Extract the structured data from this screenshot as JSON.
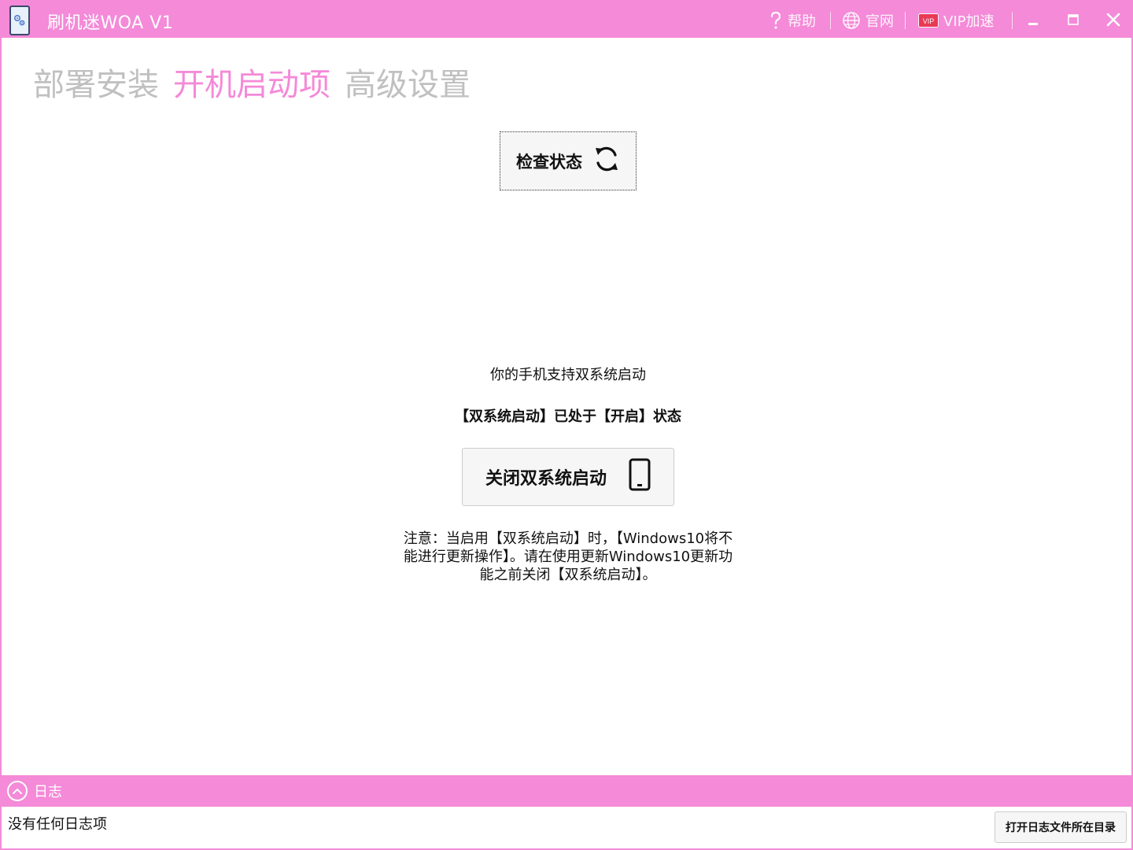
{
  "window": {
    "title": "刷机迷WOA V1",
    "accent_color": "#f48ad8"
  },
  "titlebar": {
    "help": {
      "icon": "question-icon",
      "label": "帮助"
    },
    "website": {
      "icon": "globe-icon",
      "label": "官网"
    },
    "vip": {
      "icon": "vip-badge-icon",
      "badge": "VIP",
      "label": "VIP加速"
    },
    "controls": [
      "minimize-icon",
      "maximize-icon",
      "close-icon"
    ]
  },
  "tabs": [
    {
      "label": "部署安装",
      "active": false
    },
    {
      "label": "开机启动项",
      "active": true
    },
    {
      "label": "高级设置",
      "active": false
    }
  ],
  "main": {
    "check_status_label": "检查状态",
    "check_status_icon": "refresh-icon",
    "support_text": "你的手机支持双系统启动",
    "status_text": "【双系统启动】已处于【开启】状态",
    "toggle_label": "关闭双系统启动",
    "toggle_icon": "phone-icon",
    "note_text": "注意：当启用【双系统启动】时，【Windows10将不能进行更新操作】。请在使用更新Windows10更新功能之前关闭【双系统启动】。"
  },
  "log": {
    "label": "日志",
    "toggle_icon": "chevron-up-circle-icon",
    "empty_text": "没有任何日志项",
    "open_folder_label": "打开日志文件所在目录"
  }
}
